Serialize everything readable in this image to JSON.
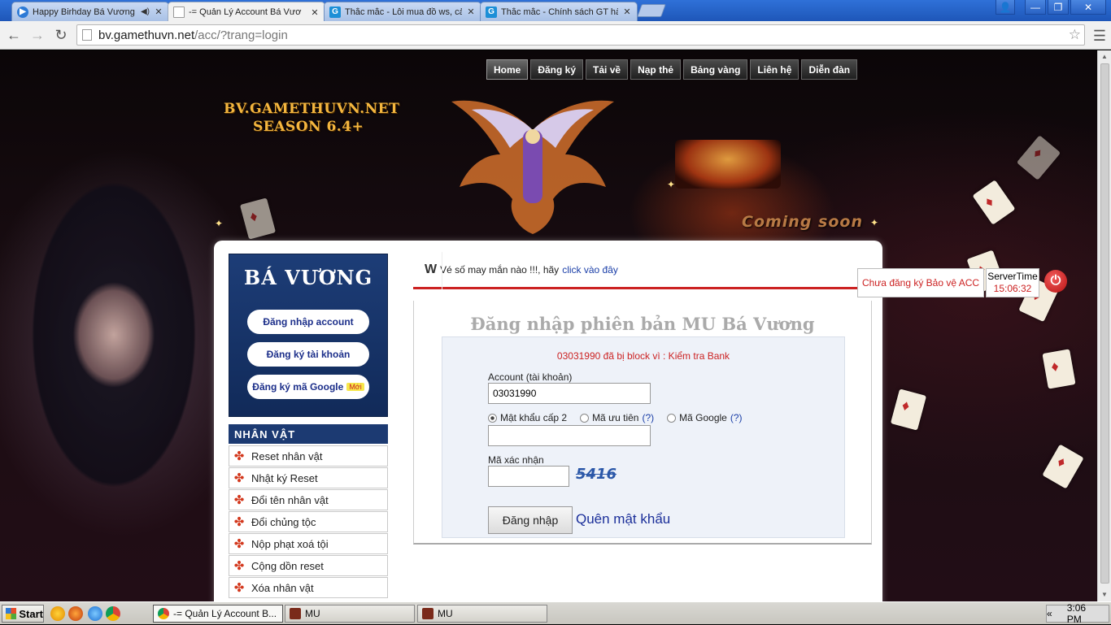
{
  "browser": {
    "tabs": [
      {
        "title": "Happy Birhday Bá Vương",
        "icon": "play-icon",
        "has_audio": true
      },
      {
        "title": "-= Quản Lý Account Bá Vươ",
        "icon": "page-icon",
        "active": true
      },
      {
        "title": "Thắc mắc - Lỗi mua đồ ws, cả",
        "icon": "g-icon"
      },
      {
        "title": "Thắc mắc - Chính sách GT hà",
        "icon": "g-icon"
      }
    ],
    "url_host": "bv.gamethuvn.net",
    "url_path": "/acc/?trang=login"
  },
  "site": {
    "banner_line1": "BV.GAMETHUVN.NET",
    "banner_line2": "SEASON 6.4+",
    "coming_soon": "Coming soon",
    "nav": [
      "Home",
      "Đăng ký",
      "Tải về",
      "Nạp thẻ",
      "Bảng vàng",
      "Liên hệ",
      "Diễn đàn"
    ],
    "nav_active": "Home"
  },
  "sidebar": {
    "title": "BÁ VƯƠNG",
    "buttons": [
      "Đăng nhập account",
      "Đăng ký tài khoản",
      "Đăng ký mã Google"
    ],
    "new_badge": "Mới",
    "section_title": "NHÂN VẬT",
    "items": [
      "Reset nhân vật",
      "Nhật ký Reset",
      "Đổi tên nhân vật",
      "Đổi chủng tộc",
      "Nộp phạt xoá tội",
      "Cộng dồn reset",
      "Xóa nhân vật"
    ]
  },
  "ticker": {
    "logo": "W",
    "text": "Vé số may mắn nào !!!, hãy",
    "link": "click vào đây",
    "warning": "Chưa đăng ký Bảo vệ ACC",
    "server_time_label": "ServerTime",
    "server_time": "15:06:32"
  },
  "login": {
    "title": "Đăng nhập phiên bản MU Bá Vương",
    "error": "03031990 đã bị block vì : Kiểm tra Bank",
    "account_label": "Account (tài khoản)",
    "account_value": "03031990",
    "radio_options": [
      {
        "label": "Mật khẩu cấp 2",
        "help": "",
        "checked": true
      },
      {
        "label": "Mã ưu tiên",
        "help": "(?)",
        "checked": false
      },
      {
        "label": "Mã Google",
        "help": "(?)",
        "checked": false
      }
    ],
    "captcha_label": "Mã xác nhận",
    "captcha_text": "5416",
    "submit_label": "Đăng nhập",
    "forgot_label": "Quên mật khẩu"
  },
  "taskbar": {
    "start": "Start",
    "tasks": [
      "-= Quản Lý Account B...",
      "MU",
      "MU"
    ],
    "tray_arrow": "«",
    "clock": "3:06 PM"
  },
  "colors": {
    "accent_red": "#cc2222",
    "sidebar_blue": "#1c3a72",
    "link_blue": "#1b3fa8"
  }
}
